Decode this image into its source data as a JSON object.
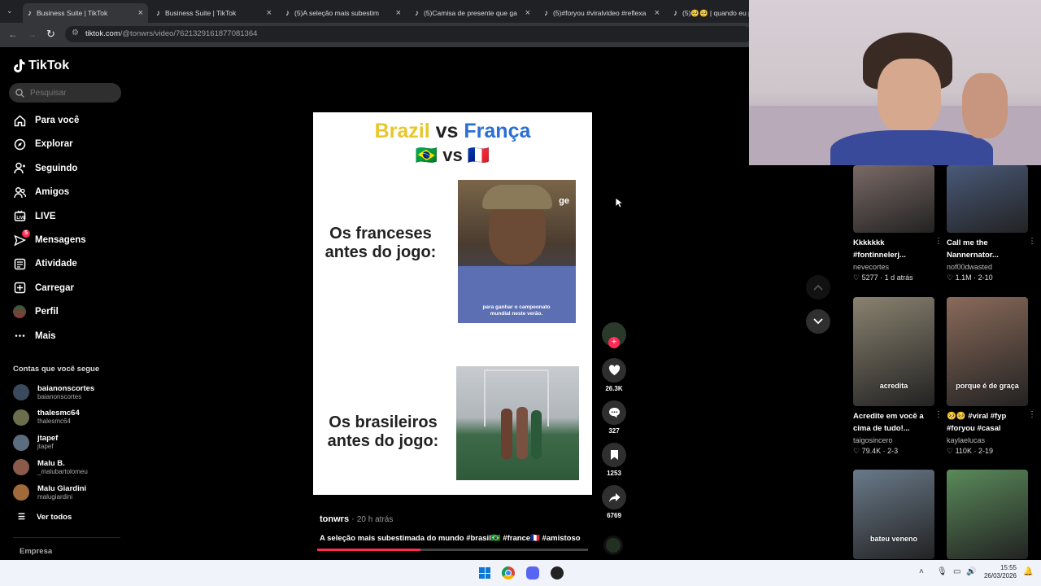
{
  "browser": {
    "tabs": [
      {
        "title": "Business Suite | TikTok",
        "active": true
      },
      {
        "title": "Business Suite | TikTok",
        "active": false
      },
      {
        "title": "(5)A seleção mais subestim",
        "active": false
      },
      {
        "title": "(5)Camisa de presente que ga",
        "active": false
      },
      {
        "title": "(5)#foryou #viralvideo #reflexa",
        "active": false
      },
      {
        "title": "(5)🥺🥺 | quando eu p",
        "active": false
      }
    ],
    "url_host": "tiktok.com",
    "url_path": "/@tonwrs/video/7621329161877081364"
  },
  "sidebar": {
    "logo": "TikTok",
    "search_placeholder": "Pesquisar",
    "nav": [
      {
        "label": "Para você",
        "icon": "home-icon"
      },
      {
        "label": "Explorar",
        "icon": "compass-icon"
      },
      {
        "label": "Seguindo",
        "icon": "following-icon"
      },
      {
        "label": "Amigos",
        "icon": "friends-icon"
      },
      {
        "label": "LIVE",
        "icon": "live-icon"
      },
      {
        "label": "Mensagens",
        "icon": "messages-icon",
        "badge": "5"
      },
      {
        "label": "Atividade",
        "icon": "activity-icon"
      },
      {
        "label": "Carregar",
        "icon": "upload-icon"
      },
      {
        "label": "Perfil",
        "icon": "profile-avatar"
      },
      {
        "label": "Mais",
        "icon": "more-icon"
      }
    ],
    "following_title": "Contas que você segue",
    "accounts": [
      {
        "name": "baianonscortes",
        "handle": "baianonscortes",
        "color": "#3a4a5c"
      },
      {
        "name": "thalesmc64",
        "handle": "thalesmc64",
        "color": "#6b6e4a"
      },
      {
        "name": "jtapef",
        "handle": "jtapef",
        "color": "#5d6d80"
      },
      {
        "name": "Malu B.",
        "handle": "_malubartolomeu",
        "color": "#8a5a4a"
      },
      {
        "name": "Malu Giardini",
        "handle": "malugiardini",
        "color": "#a06a3a"
      }
    ],
    "see_all": "Ver todos",
    "footer": "Empresa"
  },
  "video": {
    "title_brazil": "Brazil",
    "title_vs": "vs",
    "title_franca": "França",
    "flags": "🇧🇷 vs 🇫🇷",
    "caption_top": "Os franceses antes do jogo:",
    "caption_bottom": "Os brasileiros antes do jogo:",
    "frame_logo": "ge",
    "frame_subtitle": "para ganhar o campeonato mundial neste verão.",
    "author": "tonwrs",
    "time": "20 h atrás",
    "description": "A seleção mais subestimada do mundo #brasil🇧🇷 #france🇫🇷 #amistoso",
    "progress": 0.38
  },
  "actions": {
    "likes": "26.3K",
    "comments": "327",
    "saves": "1253",
    "shares": "6769"
  },
  "recommendations": [
    {
      "caption": "Kkkkkkk #fontinnelerj...",
      "author": "nevecortes",
      "likes": "5277",
      "time": "1 d atrás",
      "thumb": "#7a6a66"
    },
    {
      "caption": "Call me the Nannernator...",
      "author": "nof00dwasted",
      "likes": "1.1M",
      "time": "2-10",
      "thumb": "#4a5a7a"
    },
    {
      "caption": "Acredite em você a cima de tudo!...",
      "author": "taigosincero",
      "likes": "79.4K",
      "time": "2-3",
      "thumb": "#8a8270",
      "overlay": "acredita"
    },
    {
      "caption": "🥺🥺 #viral #fyp #foryou #casal",
      "author": "kaylaelucas",
      "likes": "110K",
      "time": "2-19",
      "thumb": "#8a6a5a",
      "overlay": "porque é de graça"
    },
    {
      "caption": "",
      "author": "",
      "likes": "",
      "time": "",
      "thumb": "#6a7a8a",
      "overlay": "bateu veneno"
    },
    {
      "caption": "",
      "author": "",
      "likes": "",
      "time": "",
      "thumb": "#5a8a5a"
    }
  ],
  "taskbar": {
    "time": "15:55",
    "date": "26/03/2026"
  }
}
